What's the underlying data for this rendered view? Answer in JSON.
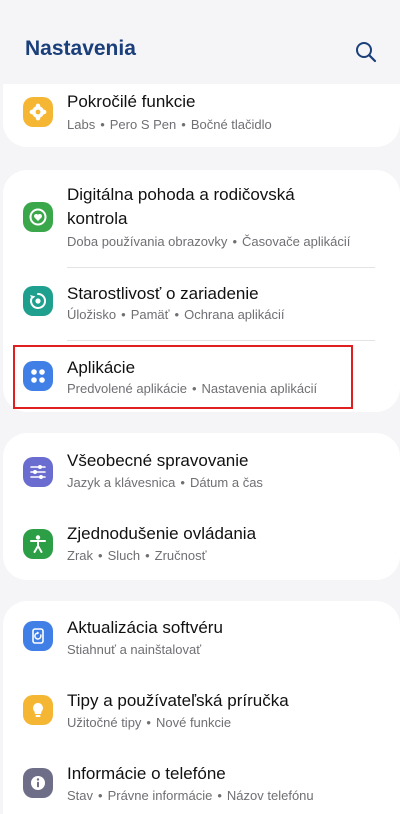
{
  "header": {
    "title": "Nastavenia"
  },
  "colors": {
    "advanced": "#f5b733",
    "wellbeing": "#3aa84a",
    "care": "#1fa08f",
    "apps": "#3f7fe6",
    "general": "#6a6ccf",
    "accessibility": "#2c9e45",
    "update": "#3f7fe6",
    "tips": "#f5b733",
    "about": "#6e6e88"
  },
  "items": [
    {
      "label": "Pokročilé funkcie",
      "sub": [
        "Labs",
        "Pero S Pen",
        "Bočné tlačidlo"
      ],
      "icon": "gear-puzzle-icon"
    },
    {
      "label": "Digitálna pohoda a rodičovská kontrola",
      "sub": [
        "Doba používania obrazovky",
        "Časovače aplikácií"
      ],
      "icon": "wellbeing-heart-icon"
    },
    {
      "label": "Starostlivosť o zariadenie",
      "sub": [
        "Úložisko",
        "Pamäť",
        "Ochrana aplikácií"
      ],
      "icon": "device-care-icon"
    },
    {
      "label": "Aplikácie",
      "sub": [
        "Predvolené aplikácie",
        "Nastavenia aplikácií"
      ],
      "icon": "apps-grid-icon"
    },
    {
      "label": "Všeobecné spravovanie",
      "sub": [
        "Jazyk a klávesnica",
        "Dátum a čas"
      ],
      "icon": "sliders-icon"
    },
    {
      "label": "Zjednodušenie ovládania",
      "sub": [
        "Zrak",
        "Sluch",
        "Zručnosť"
      ],
      "icon": "accessibility-person-icon"
    },
    {
      "label": "Aktualizácia softvéru",
      "sub": [
        "Stiahnuť a nainštalovať"
      ],
      "icon": "software-update-icon"
    },
    {
      "label": "Tipy a používateľská príručka",
      "sub": [
        "Užitočné tipy",
        "Nové funkcie"
      ],
      "icon": "lightbulb-icon"
    },
    {
      "label": "Informácie o telefóne",
      "sub": [
        "Stav",
        "Právne informácie",
        "Názov telefónu"
      ],
      "icon": "info-icon"
    }
  ]
}
